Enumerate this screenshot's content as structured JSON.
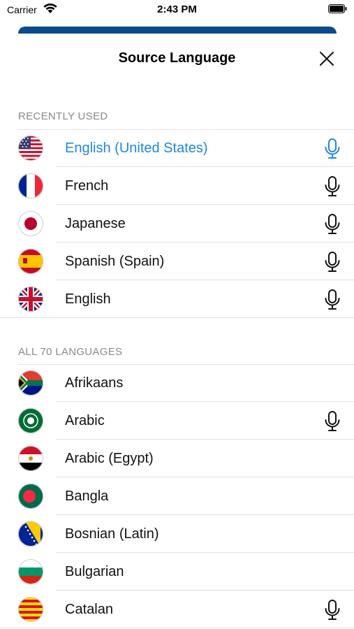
{
  "status_bar": {
    "carrier": "Carrier",
    "time": "2:43 PM"
  },
  "sheet": {
    "title": "Source Language"
  },
  "sections": {
    "recent_header": "RECENTLY USED",
    "all_header": "ALL 70 LANGUAGES"
  },
  "recent": [
    {
      "name": "English (United States)",
      "flag": "us-flag-icon",
      "mic": true,
      "active": true
    },
    {
      "name": "French",
      "flag": "france-flag-icon",
      "mic": true,
      "active": false
    },
    {
      "name": "Japanese",
      "flag": "japan-flag-icon",
      "mic": true,
      "active": false
    },
    {
      "name": "Spanish (Spain)",
      "flag": "spain-flag-icon",
      "mic": true,
      "active": false
    },
    {
      "name": "English",
      "flag": "uk-flag-icon",
      "mic": true,
      "active": false
    }
  ],
  "all": [
    {
      "name": "Afrikaans",
      "flag": "south-africa-flag-icon",
      "mic": false
    },
    {
      "name": "Arabic",
      "flag": "arab-league-flag-icon",
      "mic": true
    },
    {
      "name": "Arabic (Egypt)",
      "flag": "egypt-flag-icon",
      "mic": false
    },
    {
      "name": "Bangla",
      "flag": "bangladesh-flag-icon",
      "mic": false
    },
    {
      "name": "Bosnian (Latin)",
      "flag": "bosnia-flag-icon",
      "mic": false
    },
    {
      "name": "Bulgarian",
      "flag": "bulgaria-flag-icon",
      "mic": false
    },
    {
      "name": "Catalan",
      "flag": "catalonia-flag-icon",
      "mic": true
    }
  ],
  "colors": {
    "accent": "#1f87e0",
    "header_gray": "#8a8a8e",
    "brand_blue": "#0b4a8c"
  }
}
